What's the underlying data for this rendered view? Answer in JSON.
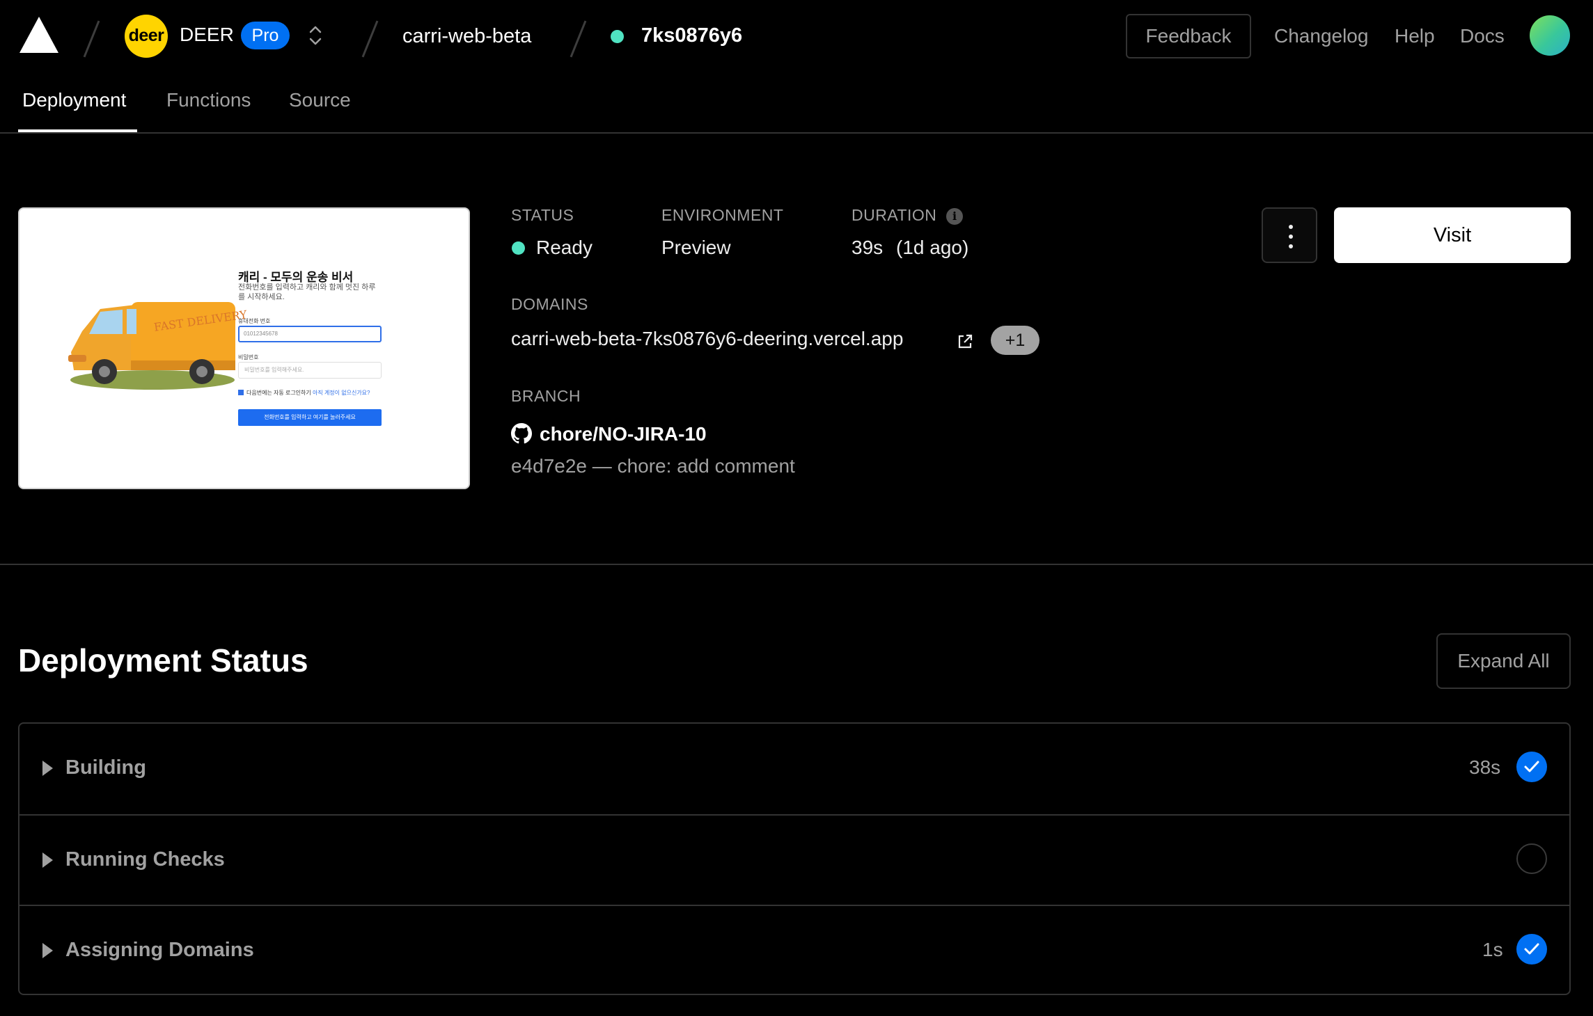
{
  "topbar": {
    "team_initials": "deer",
    "team_name": "DEER",
    "plan": "Pro",
    "project": "carri-web-beta",
    "deployment_id": "7ks0876y6",
    "feedback_label": "Feedback",
    "links": [
      "Changelog",
      "Help",
      "Docs"
    ]
  },
  "tabs": [
    "Deployment",
    "Functions",
    "Source"
  ],
  "preview": {
    "heading": "캐리 - 모두의 운송 비서",
    "subtitle": "전화번호를 입력하고 캐리와 함께 멋진 하루를 시작하세요.",
    "van_text": "FAST DELIVERY",
    "phone_label": "휴대전화 번호",
    "phone_value": "01012345678",
    "password_label": "비밀번호",
    "password_placeholder": "비밀번호를 입력해주세요.",
    "remember_text": "다음번에는 자동 로그인하기",
    "forgot_link": "아직 계정이 없으신가요?",
    "submit_label": "전화번호를 입력하고 여기를 눌러주세요"
  },
  "deployment": {
    "status_label": "STATUS",
    "status_value": "Ready",
    "environment_label": "ENVIRONMENT",
    "environment_value": "Preview",
    "duration_label": "DURATION",
    "duration_value": "39s",
    "duration_ago": "(1d ago)",
    "domains_label": "DOMAINS",
    "domain": "carri-web-beta-7ks0876y6-deering.vercel.app",
    "more_domains": "+1",
    "branch_label": "BRANCH",
    "branch": "chore/NO-JIRA-10",
    "commit": "e4d7e2e — chore: add comment",
    "visit_label": "Visit"
  },
  "status_section": {
    "title": "Deployment Status",
    "expand_label": "Expand All",
    "steps": [
      {
        "name": "Building",
        "time": "38s",
        "state": "done"
      },
      {
        "name": "Running Checks",
        "time": "",
        "state": "pending"
      },
      {
        "name": "Assigning Domains",
        "time": "1s",
        "state": "done"
      }
    ]
  },
  "colors": {
    "accent": "#0070f3",
    "ready": "#50e3c2",
    "border": "#333333",
    "muted_text": "#a1a1a1"
  }
}
